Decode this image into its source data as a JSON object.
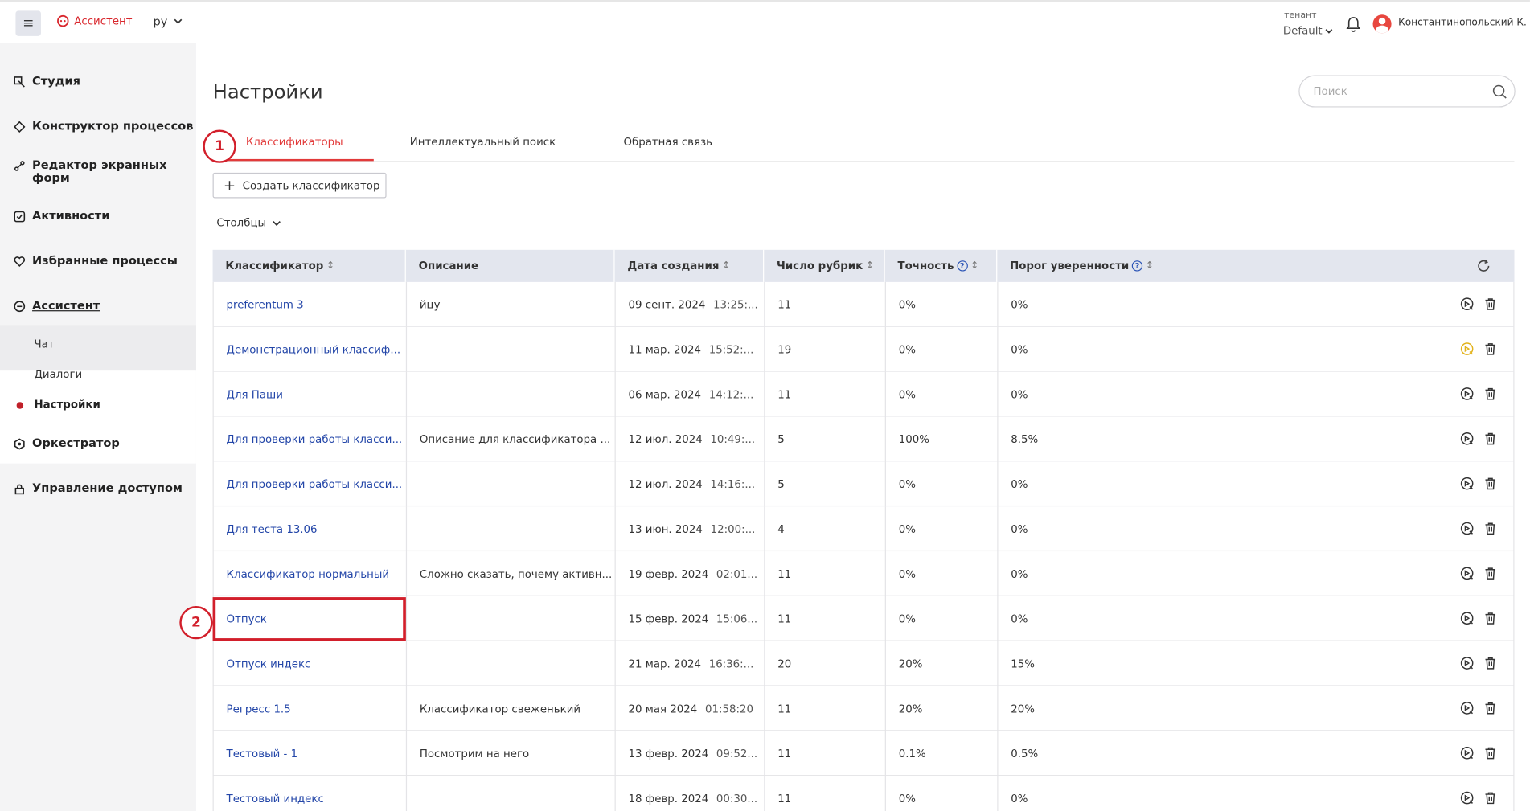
{
  "header": {
    "menu_icon": "hamburger-icon",
    "app_name": "Ассистент",
    "language": "ру",
    "tenant_label": "тенант",
    "tenant_value": "Default",
    "username": "Константинопольский К."
  },
  "sidebar": {
    "items": [
      {
        "label": "Студия",
        "icon": "studio-icon"
      },
      {
        "label": "Конструктор процессов",
        "icon": "process-builder-icon"
      },
      {
        "label": "Редактор экранных форм",
        "icon": "form-editor-icon"
      },
      {
        "label": "Активности",
        "icon": "activities-icon"
      },
      {
        "label": "Избранные процессы",
        "icon": "heart-icon"
      },
      {
        "label": "Ассистент",
        "icon": "assistant-icon"
      },
      {
        "label": "Оркестратор",
        "icon": "orchestrator-icon"
      },
      {
        "label": "Управление доступом",
        "icon": "access-icon"
      }
    ],
    "sub_items": [
      {
        "label": "Чат"
      },
      {
        "label": "Диалоги"
      },
      {
        "label": "Настройки"
      }
    ]
  },
  "page": {
    "title": "Настройки",
    "search_placeholder": "Поиск",
    "tabs": [
      {
        "label": "Классификаторы"
      },
      {
        "label": "Интеллектуальный поиск"
      },
      {
        "label": "Обратная связь"
      }
    ],
    "create_button": "Создать классификатор",
    "columns_button": "Столбцы"
  },
  "table": {
    "headers": [
      "Классификатор",
      "Описание",
      "Дата создания",
      "Число рубрик",
      "Точность",
      "Порог уверенности"
    ],
    "rows": [
      {
        "name": "preferentum 3",
        "desc": "йцу",
        "date": "09 сент. 2024",
        "time": "13:25:...",
        "count": "11",
        "acc": "0%",
        "thr": "0%",
        "highlight": false
      },
      {
        "name": "Демонстрационный классиф...",
        "desc": "",
        "date": "11 мар. 2024",
        "time": "15:52:...",
        "count": "19",
        "acc": "0%",
        "thr": "0%",
        "highlight": true
      },
      {
        "name": "Для Паши",
        "desc": "",
        "date": "06 мар. 2024",
        "time": "14:12:...",
        "count": "11",
        "acc": "0%",
        "thr": "0%",
        "highlight": false
      },
      {
        "name": "Для проверки работы класси...",
        "desc": "Описание для классификатора ...",
        "date": "12 июл. 2024",
        "time": "10:49:...",
        "count": "5",
        "acc": "100%",
        "thr": "8.5%",
        "highlight": false
      },
      {
        "name": "Для проверки работы класси...",
        "desc": "",
        "date": "12 июл. 2024",
        "time": "14:16:...",
        "count": "5",
        "acc": "0%",
        "thr": "0%",
        "highlight": false
      },
      {
        "name": "Для теста 13.06",
        "desc": "",
        "date": "13 июн. 2024",
        "time": "12:00:...",
        "count": "4",
        "acc": "0%",
        "thr": "0%",
        "highlight": false
      },
      {
        "name": "Классификатор нормальный",
        "desc": "Сложно сказать, почему активн...",
        "date": "19 февр. 2024",
        "time": "02:01...",
        "count": "11",
        "acc": "0%",
        "thr": "0%",
        "highlight": false
      },
      {
        "name": "Отпуск",
        "desc": "",
        "date": "15 февр. 2024",
        "time": "15:06...",
        "count": "11",
        "acc": "0%",
        "thr": "0%",
        "highlight": false
      },
      {
        "name": "Отпуск индекс",
        "desc": "",
        "date": "21 мар. 2024",
        "time": "16:36:...",
        "count": "20",
        "acc": "20%",
        "thr": "15%",
        "highlight": false
      },
      {
        "name": "Регресс 1.5",
        "desc": "Классификатор свеженький",
        "date": "20 мая 2024",
        "time": "01:58:20",
        "count": "11",
        "acc": "20%",
        "thr": "20%",
        "highlight": false
      },
      {
        "name": "Тестовый - 1",
        "desc": "Посмотрим на него",
        "date": "13 февр. 2024",
        "time": "09:52...",
        "count": "11",
        "acc": "0.1%",
        "thr": "0.5%",
        "highlight": false
      },
      {
        "name": "Тестовый индекс",
        "desc": "",
        "date": "18 февр. 2024",
        "time": "00:30...",
        "count": "11",
        "acc": "0%",
        "thr": "0%",
        "highlight": false
      }
    ]
  },
  "annotations": {
    "marker_1": "1",
    "marker_2": "2"
  },
  "colors": {
    "accent": "#e23a3a",
    "link": "#2346a8",
    "header_bg": "#e3e6ee",
    "highlight_icon": "#e2b21a",
    "annotation": "#d21f2b"
  }
}
